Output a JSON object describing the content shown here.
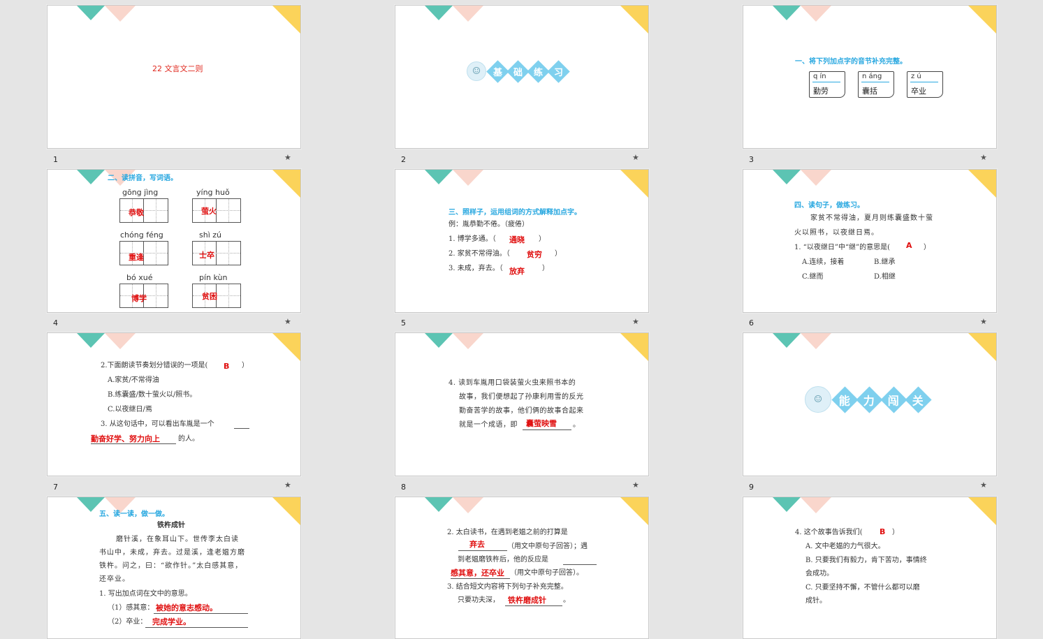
{
  "slides": [
    {
      "num": "1",
      "title": "22 文言文二则"
    },
    {
      "num": "2",
      "banner": [
        "基",
        "础",
        "练",
        "习"
      ]
    },
    {
      "num": "3",
      "caption": "一、将下列加点字的音节补充完整。",
      "boxes": [
        {
          "py": "q ín",
          "word": "勤劳"
        },
        {
          "py": "n áng",
          "word": "囊括"
        },
        {
          "py": "z ú",
          "word": "卒业"
        }
      ]
    },
    {
      "num": "4",
      "caption": "二、读拼音，写词语。",
      "items": [
        {
          "py": "gōng  jìng",
          "ans": "恭敬"
        },
        {
          "py": "yíng  huǒ",
          "ans": "萤火"
        },
        {
          "py": "chóng  féng",
          "ans": "重逢"
        },
        {
          "py": "shì   zú",
          "ans": "士卒"
        },
        {
          "py": "bó   xué",
          "ans": "博学"
        },
        {
          "py": "pín  kùn",
          "ans": "贫困"
        }
      ]
    },
    {
      "num": "5",
      "caption": "三、照样子，运用组词的方式解释加点字。",
      "example": "例：胤恭勤不倦。（疲倦）",
      "lines": [
        {
          "q": "1. 博学多通。（",
          "a": "通晓",
          "end": "）"
        },
        {
          "q": "2. 家贫不常得油。（",
          "a": "贫穷",
          "end": "）"
        },
        {
          "q": "3. 未成，弃去。（",
          "a": "放弃",
          "end": "）"
        }
      ]
    },
    {
      "num": "6",
      "caption": "四、读句子，做练习。",
      "passage": [
        "家贫不常得油，夏月则练囊盛数十萤",
        "火以照书，以夜继日焉。"
      ],
      "question": "1. “以夜继日”中“继”的意思是(",
      "answer": "A",
      "qend": "）",
      "options": [
        "A.连续，接着",
        "B.继承",
        "C.继而",
        "D.相继"
      ]
    },
    {
      "num": "7",
      "q2": "2.下面朗读节奏划分错误的一项是(",
      "a2": "B",
      "q2end": "）",
      "options": [
        "A.家贫/不常得油",
        "B.练囊盛/数十萤火以/照书。",
        "C.以夜继日/焉"
      ],
      "q3": "3. 从这句话中，可以看出车胤是一个",
      "a3": "勤奋好学、努力向上",
      "q3end": "的人。"
    },
    {
      "num": "8",
      "lines": [
        "4. 读到车胤用口袋装萤火虫来照书本的",
        "故事，我们便想起了孙康利用雪的反光",
        "勤奋苦学的故事，他们俩的故事合起来",
        "就是一个成语，即"
      ],
      "answer": "囊萤映雪",
      "end": "。"
    },
    {
      "num": "9",
      "banner": [
        "能",
        "力",
        "闯",
        "关"
      ]
    },
    {
      "num": "10",
      "caption": "五、读一读，做一做。",
      "story_title": "铁杵成针",
      "passage": [
        "磨针溪，在象耳山下。世传李太白读",
        "书山中，未成，弃去。过是溪，逢老媪方磨",
        "铁杵。问之，曰：“欲作针。”太白感其意，",
        "还卒业。"
      ],
      "q1": "1. 写出加点词在文中的意思。",
      "sub": [
        {
          "q": "（1）感其意：",
          "a": "被她的意志感动。"
        },
        {
          "q": "（2）卒业：",
          "a": "完成学业。"
        }
      ]
    },
    {
      "num": "11",
      "q2a": "2. 太白读书，在遇到老媪之前的打算是",
      "a2a": "弃去",
      "q2b": "（用文中原句子回答）；遇",
      "q2c": "到老媪磨铁杵后，他的反应是",
      "a2b": "感其意，还卒业",
      "q2d": "（用文中原句子回答）。",
      "q3": "3. 结合短文内容将下列句子补充完整。",
      "q3b": "只要功夫深，",
      "a3": "铁杵磨成针",
      "q3end": "。"
    },
    {
      "num": "12",
      "q4": "4. 这个故事告诉我们(",
      "a4": "B",
      "q4end": "）",
      "options": [
        "A. 文中老媪的力气很大。",
        "B. 只要我们有毅力，肯下苦功，事情终",
        "会成功。",
        "C. 只要坚持不懈，不管什么都可以磨",
        "成针。"
      ]
    }
  ],
  "star_icon": "★"
}
